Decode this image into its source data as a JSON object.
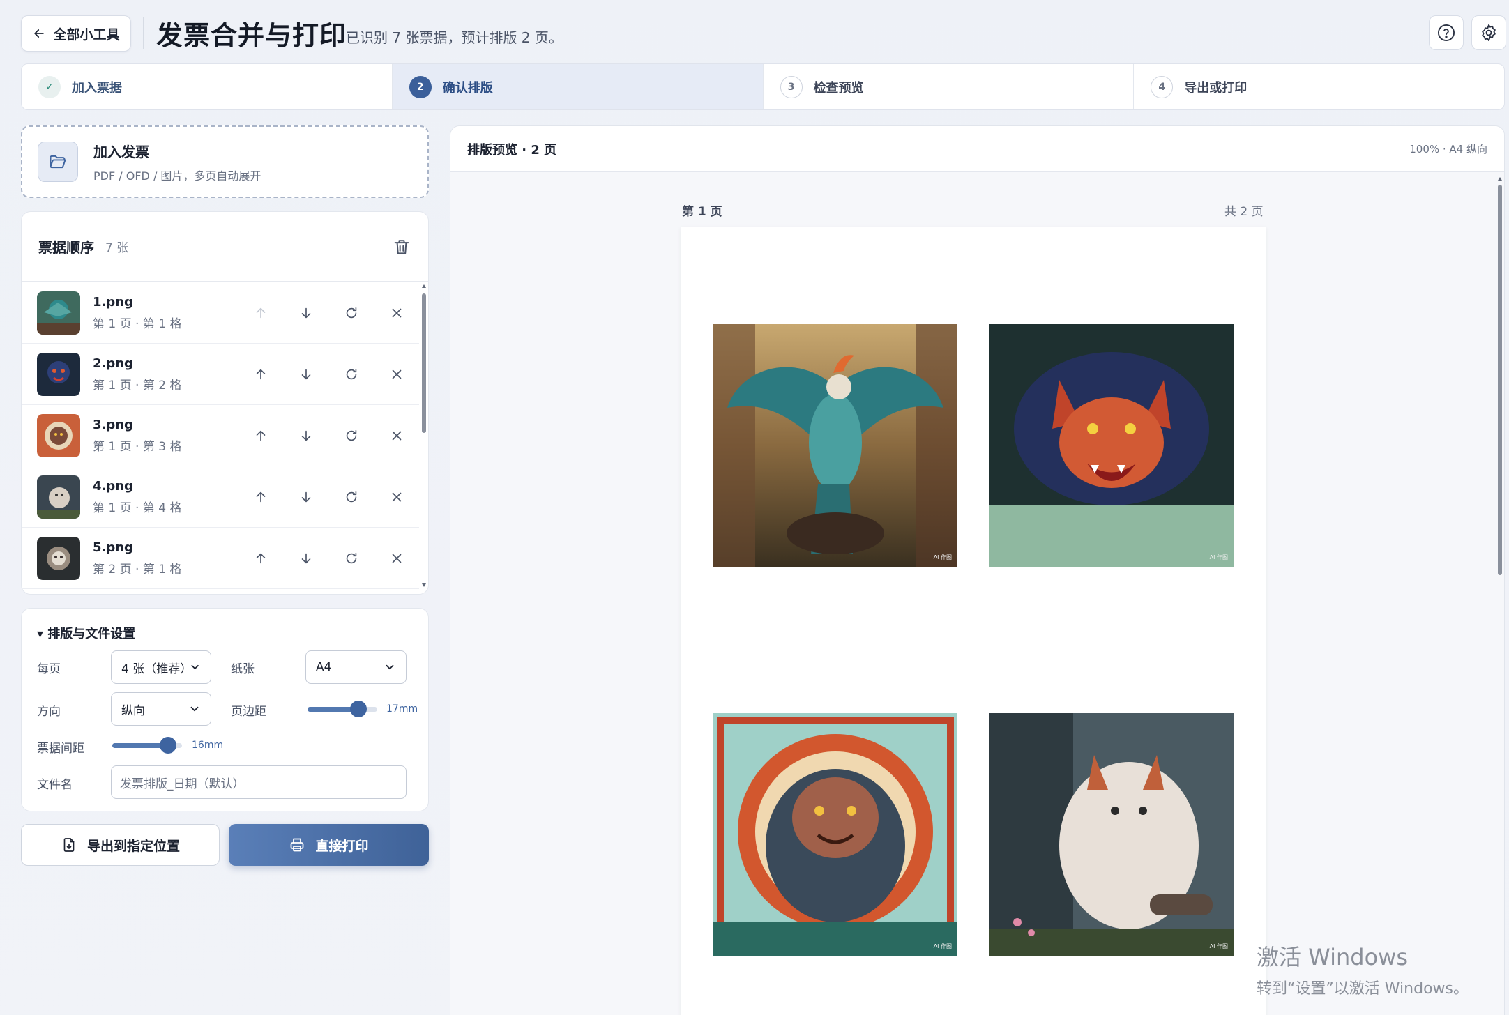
{
  "header": {
    "back_label": "全部小工具",
    "title": "发票合并与打印",
    "subtitle": "已识别 7 张票据，预计排版 2 页。"
  },
  "steps": [
    {
      "num": "✓",
      "label": "加入票据",
      "state": "done"
    },
    {
      "num": "2",
      "label": "确认排版",
      "state": "active"
    },
    {
      "num": "3",
      "label": "检查预览",
      "state": "todo"
    },
    {
      "num": "4",
      "label": "导出或打印",
      "state": "todo"
    }
  ],
  "upload": {
    "title": "加入发票",
    "desc": "PDF / OFD / 图片，多页自动展开"
  },
  "list": {
    "title": "票据顺序",
    "count": "7 张",
    "items": [
      {
        "name": "1.png",
        "pos": "第 1 页 · 第 1 格"
      },
      {
        "name": "2.png",
        "pos": "第 1 页 · 第 2 格"
      },
      {
        "name": "3.png",
        "pos": "第 1 页 · 第 3 格"
      },
      {
        "name": "4.png",
        "pos": "第 1 页 · 第 4 格"
      },
      {
        "name": "5.png",
        "pos": "第 2 页 · 第 1 格"
      }
    ]
  },
  "settings": {
    "title": "▾ 排版与文件设置",
    "per_page_label": "每页",
    "per_page_value": "4 张（推荐）",
    "paper_label": "纸张",
    "paper_value": "A4",
    "orientation_label": "方向",
    "orientation_value": "纵向",
    "margin_label": "页边距",
    "margin_value": "17mm",
    "margin_fraction": 0.8,
    "gap_label": "票据间距",
    "gap_value": "16mm",
    "gap_fraction": 0.9,
    "filename_label": "文件名",
    "filename_placeholder": "发票排版_日期（默认）"
  },
  "actions": {
    "export_label": "导出到指定位置",
    "print_label": "直接打印"
  },
  "preview": {
    "title": "排版预览 · 2 页",
    "zoom": "100% · A4 纵向",
    "page_label": "第 1 页",
    "page_total": "共 2 页",
    "watermark": "AI 作图"
  },
  "os_watermark": {
    "line1": "激活 Windows",
    "line2": "转到“设置”以激活 Windows。"
  },
  "colors": {
    "accent": "#3e64a0",
    "done_check": "#2c8c7a"
  }
}
